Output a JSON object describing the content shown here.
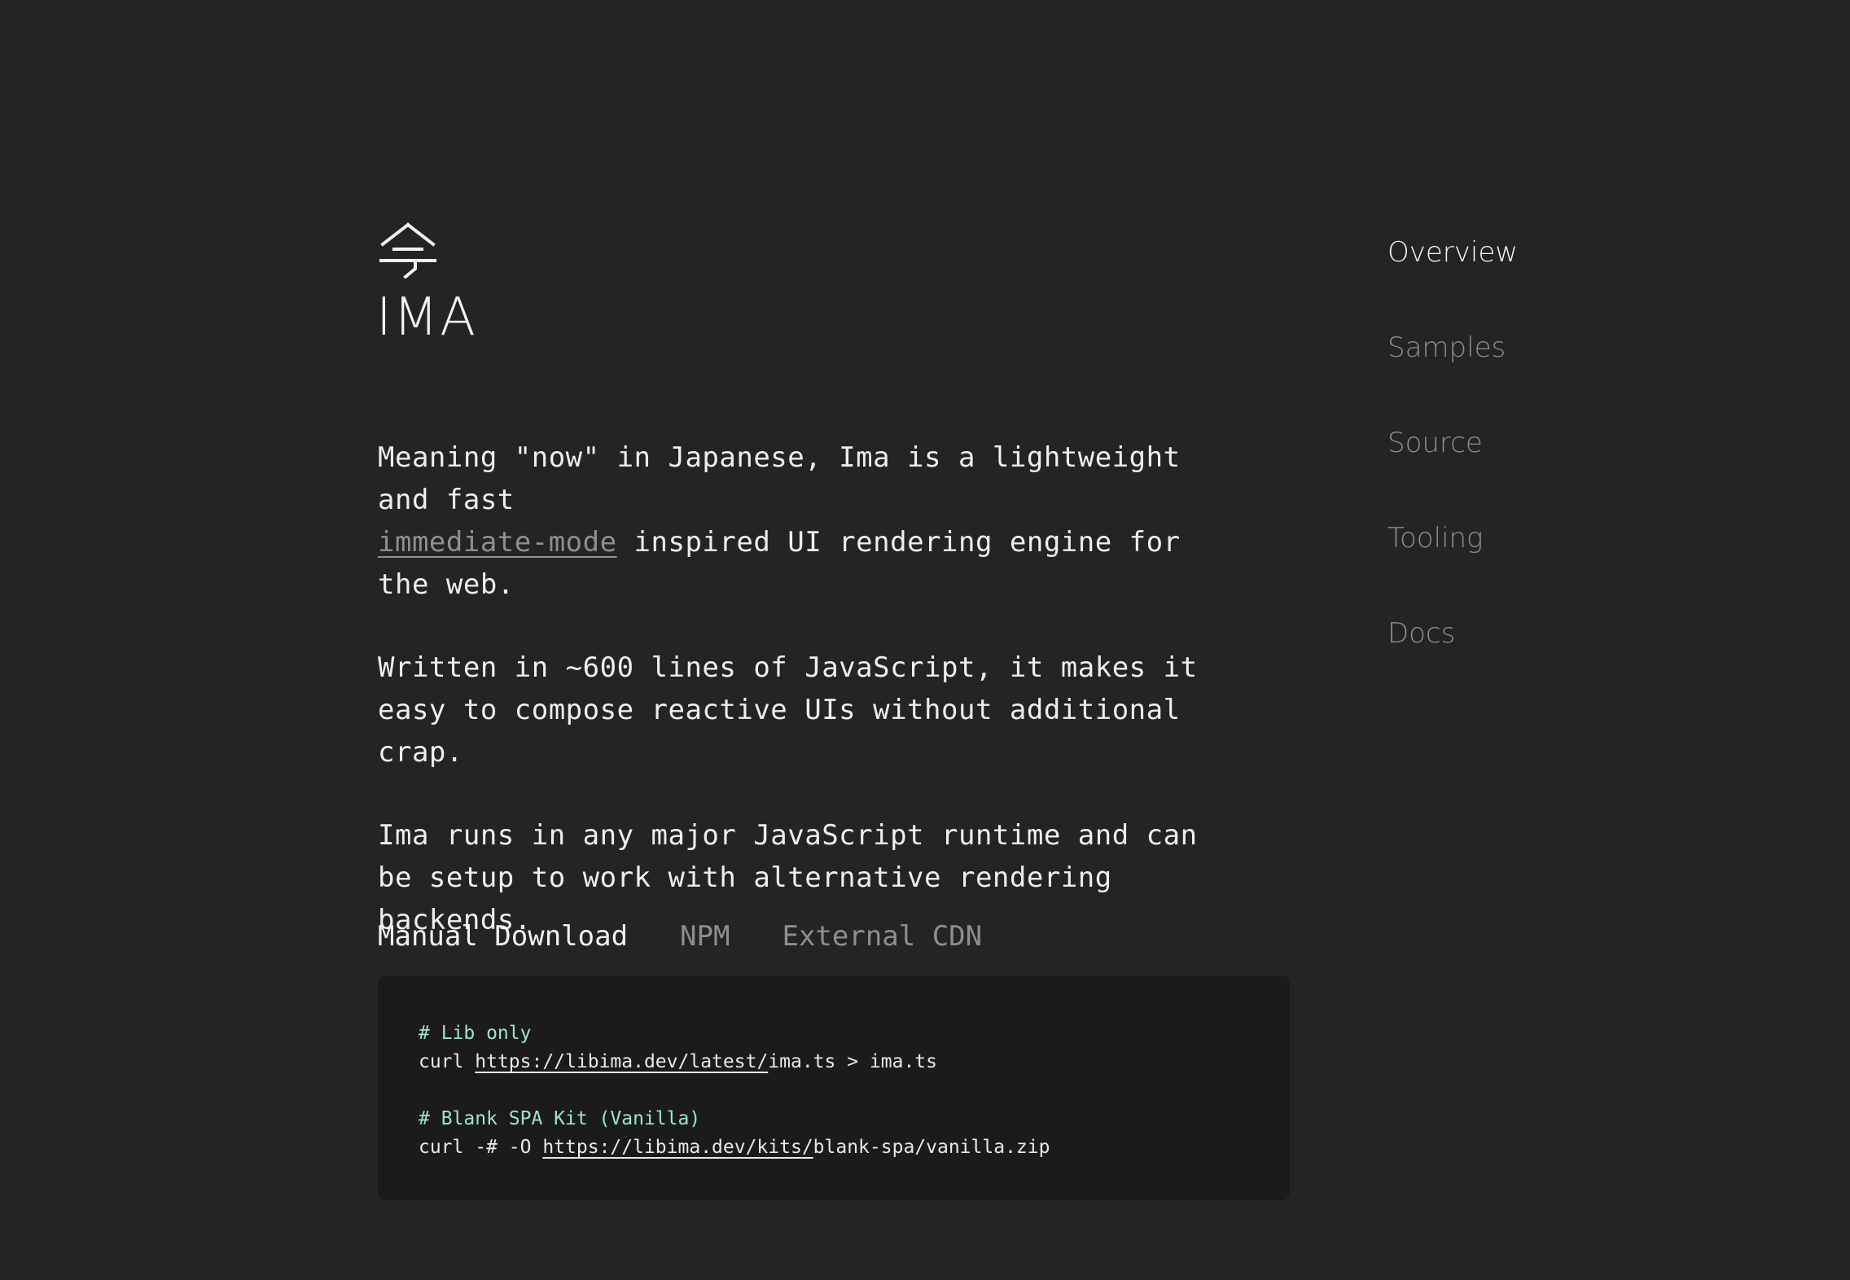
{
  "header": {
    "logo_icon": "ima-kanji-logo-icon",
    "title": "IMA"
  },
  "intro": {
    "p1_text_a": "Meaning \"now\" in Japanese, Ima is a lightweight and fast",
    "p1_link": "immediate-mode",
    "p1_text_b": " inspired UI rendering engine for the web.",
    "p2": "Written in ~600 lines of JavaScript, it makes it easy to compose reactive UIs without additional crap.",
    "p3": "Ima runs in any major JavaScript runtime and can be setup to work with alternative rendering backends."
  },
  "tabs": [
    {
      "label": "Manual Download",
      "active": true
    },
    {
      "label": "NPM",
      "active": false
    },
    {
      "label": "External CDN",
      "active": false
    }
  ],
  "code": {
    "comment1": "# Lib only",
    "line1_prefix": "curl ",
    "line1_url": "https://libima.dev/latest/",
    "line1_suffix": "ima.ts > ima.ts",
    "comment2": "# Blank SPA Kit (Vanilla)",
    "line2_prefix": "curl -# -O ",
    "line2_url": "https://libima.dev/kits/",
    "line2_suffix": "blank-spa/vanilla.zip"
  },
  "nav": [
    {
      "label": "Overview",
      "active": true
    },
    {
      "label": "Samples",
      "active": false
    },
    {
      "label": "Source",
      "active": false
    },
    {
      "label": "Tooling",
      "active": false
    },
    {
      "label": "Docs",
      "active": false
    }
  ],
  "colors": {
    "background": "#242424",
    "code_background": "#1b1b1b",
    "text": "#f2f2f2",
    "muted": "#8e8e8e",
    "comment": "#9fe3cf"
  }
}
